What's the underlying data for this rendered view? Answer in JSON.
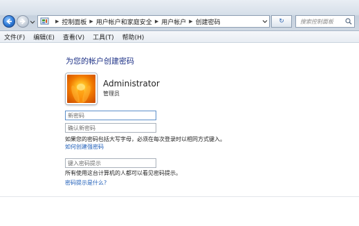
{
  "address": {
    "breadcrumbs": [
      "控制面板",
      "用户帐户和家庭安全",
      "用户帐户",
      "创建密码"
    ],
    "refresh_label": "↻",
    "search_placeholder": "搜索控制面板"
  },
  "menu": [
    {
      "label": "文件(F)"
    },
    {
      "label": "编辑(E)"
    },
    {
      "label": "查看(V)"
    },
    {
      "label": "工具(T)"
    },
    {
      "label": "帮助(H)"
    }
  ],
  "main": {
    "title": "为您的帐户创建密码",
    "user_name": "Administrator",
    "user_role": "管理员",
    "new_password_placeholder": "新密码",
    "confirm_password_placeholder": "确认新密码",
    "caps_note": "如果您的密码包括大写字母，必须在每次登录时以相同方式键入。",
    "strong_password_link": "如何创建强密码",
    "hint_placeholder": "键入密码提示",
    "hint_note": "所有使用这台计算机的人都可以看见密码提示。",
    "hint_link": "密码提示是什么?"
  },
  "colors": {
    "title": "#1e3287",
    "link": "#1c5cb8"
  }
}
